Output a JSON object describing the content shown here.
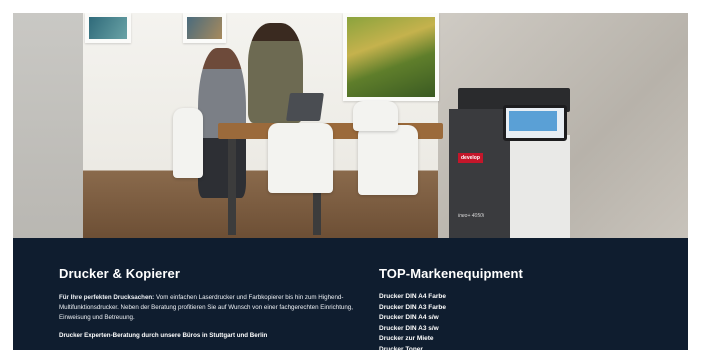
{
  "left_section": {
    "heading": "Drucker & Kopierer",
    "intro_bold": "Für Ihre perfekten Drucksachen:",
    "intro_text": " Vom einfachen Laserdrucker und Farbkopierer bis hin zum Highend-Multifunktionsdrucker. Neben der Beratung profitieren Sie auf Wunsch von einer fachgerechten Einrichtung, Einweisung und Betreuung.",
    "note": "Drucker Experten-Beratung durch unsere Büros in Stuttgart und Berlin"
  },
  "right_section": {
    "heading": "TOP-Markenequipment",
    "links": [
      "Drucker DIN A4 Farbe",
      "Drucker DIN A3 Farbe",
      "Drucker DIN A4 s/w",
      "Drucker DIN A3 s/w",
      "Drucker zur Miete",
      "Drucker Toner"
    ]
  },
  "hero": {
    "printer_brand": "develop",
    "printer_model": "ineo+ 4050i"
  },
  "colors": {
    "band_background": "#0f1d2f",
    "text": "#ffffff"
  }
}
